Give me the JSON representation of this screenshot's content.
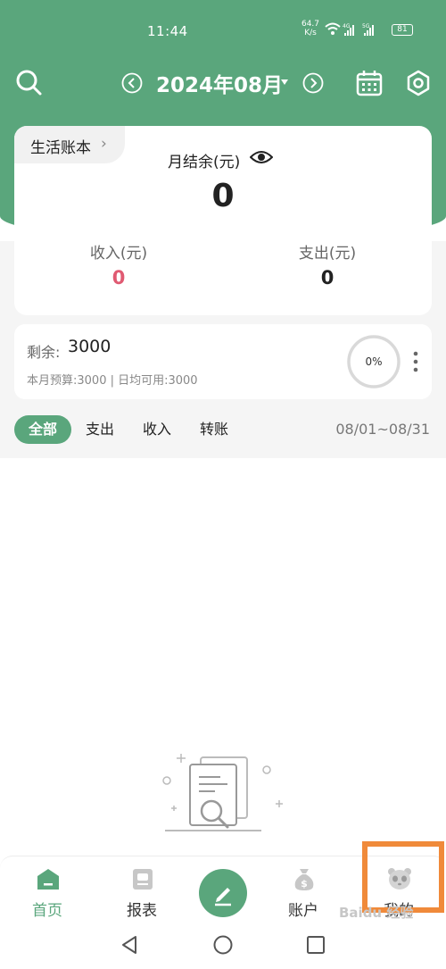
{
  "colors": {
    "accent": "#5aa67c",
    "income": "#e05a72",
    "highlight": "#f08a3a"
  },
  "status_bar": {
    "time": "11:44",
    "net_speed": "64.7",
    "net_unit": "K/s",
    "battery": "81"
  },
  "header": {
    "month": "2024年08月",
    "icons": [
      "search-icon",
      "chevron-left-icon",
      "chevron-right-icon",
      "calendar-icon",
      "gear-icon"
    ]
  },
  "summary": {
    "book_label": "生活账本",
    "balance_label": "月结余(元)",
    "balance_value": "0",
    "income_label": "收入(元)",
    "income_value": "0",
    "expense_label": "支出(元)",
    "expense_value": "0"
  },
  "budget": {
    "remaining_label": "剩余:",
    "remaining_value": "3000",
    "detail": "本月预算:3000 | 日均可用:3000",
    "progress_text": "0%",
    "progress": 0
  },
  "filters": {
    "tabs": [
      "全部",
      "支出",
      "收入",
      "转账"
    ],
    "active": "全部",
    "date_range": "08/01~08/31"
  },
  "tabbar": {
    "items": [
      {
        "label": "首页",
        "icon": "home-icon",
        "active": true
      },
      {
        "label": "报表",
        "icon": "report-icon",
        "active": false
      },
      {
        "label": "账户",
        "icon": "money-bag-icon",
        "active": false
      },
      {
        "label": "我的",
        "icon": "panda-icon",
        "active": false
      }
    ]
  },
  "watermark": "Baidu 经验"
}
